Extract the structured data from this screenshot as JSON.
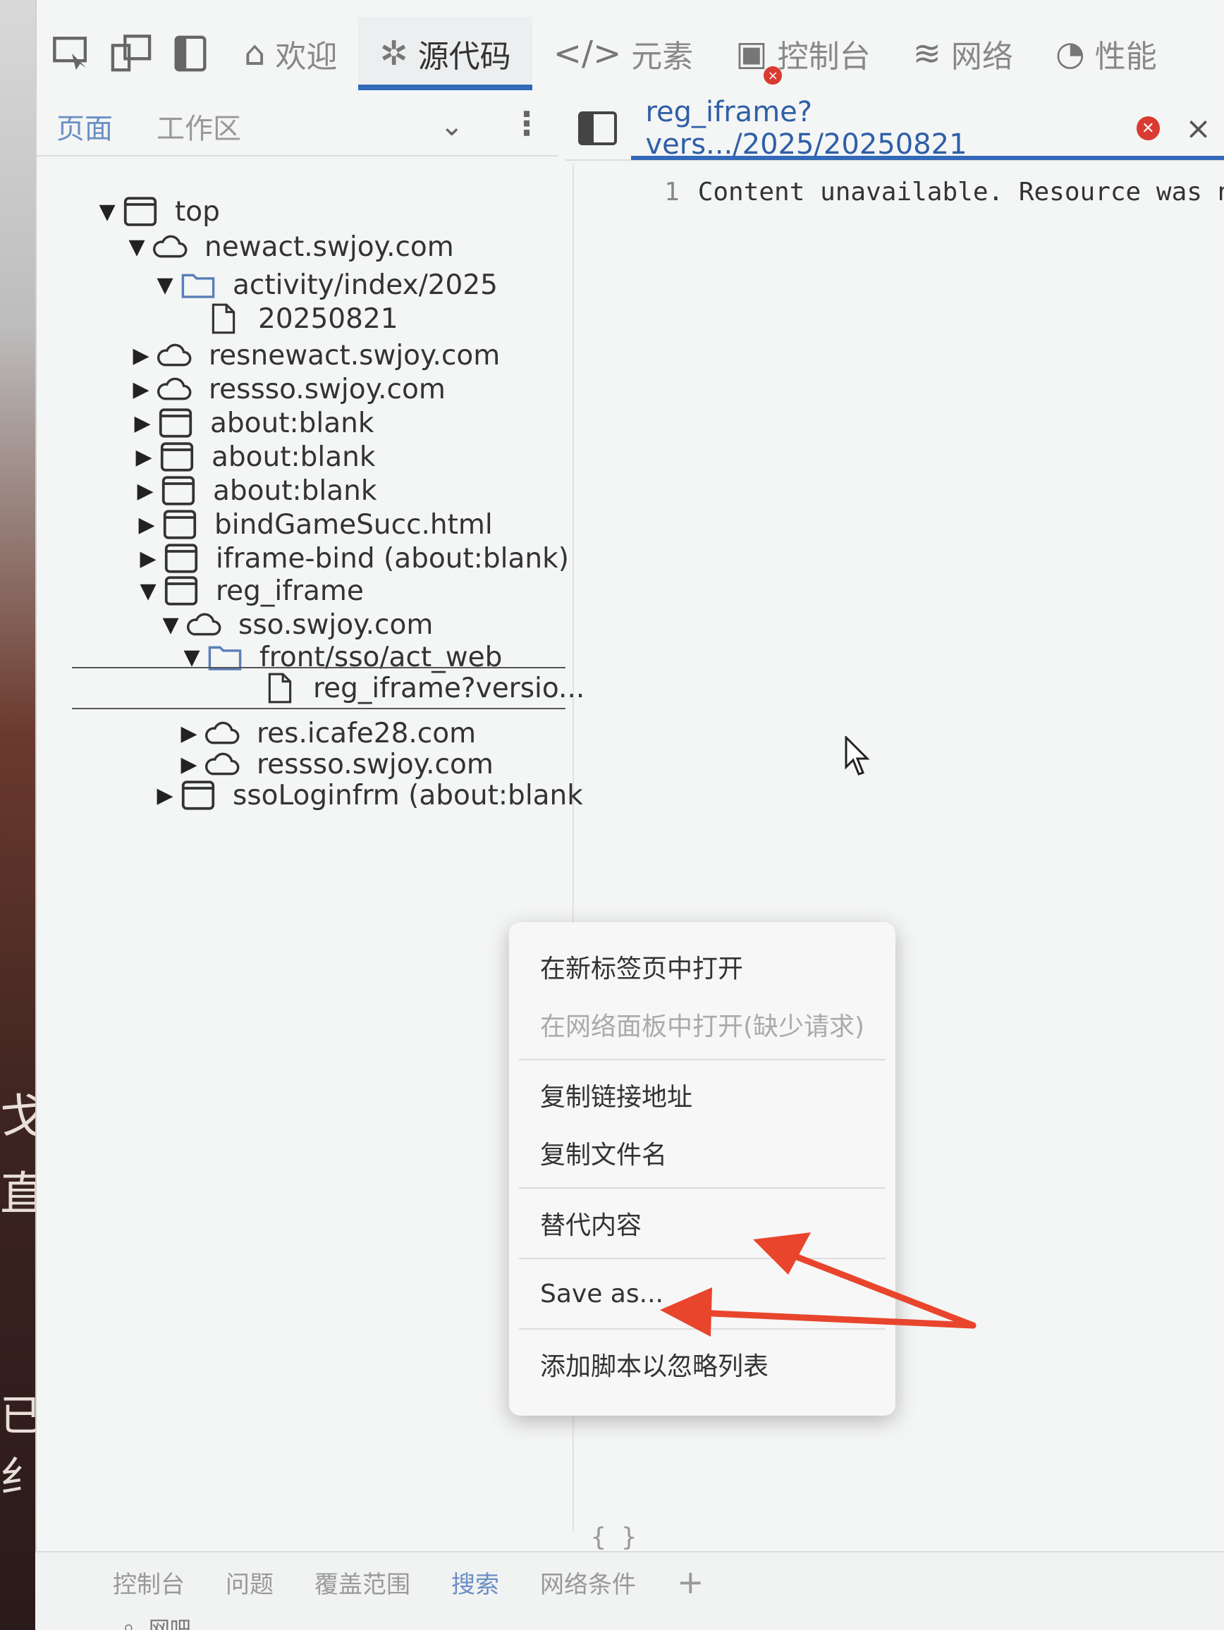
{
  "top_tabs": [
    {
      "label": "欢迎",
      "icon": "home-icon"
    },
    {
      "label": "源代码",
      "icon": "bug-icon",
      "active": true
    },
    {
      "label": "元素",
      "icon": "code-brackets-icon"
    },
    {
      "label": "控制台",
      "icon": "console-icon",
      "badge": "×"
    },
    {
      "label": "网络",
      "icon": "wifi-icon"
    },
    {
      "label": "性能",
      "icon": "gauge-icon"
    }
  ],
  "sub_tabs": {
    "page": "页面",
    "workspace": "工作区"
  },
  "editor": {
    "tab_label": "reg_iframe?vers.../2025/20250821",
    "close": "×",
    "line_number": "1",
    "line_text": "Content unavailable. Resource was not",
    "braces": "{ }"
  },
  "tree": [
    {
      "label": "top",
      "arrow": "▼",
      "icon": "frame"
    },
    {
      "label": "newact.swjoy.com",
      "arrow": "▼",
      "icon": "cloud"
    },
    {
      "label": "activity/index/2025",
      "arrow": "▼",
      "icon": "folder"
    },
    {
      "label": "20250821",
      "arrow": "",
      "icon": "file"
    },
    {
      "label": "resnewact.swjoy.com",
      "arrow": "▶",
      "icon": "cloud"
    },
    {
      "label": "ressso.swjoy.com",
      "arrow": "▶",
      "icon": "cloud"
    },
    {
      "label": "about:blank",
      "arrow": "▶",
      "icon": "frame"
    },
    {
      "label": "about:blank",
      "arrow": "▶",
      "icon": "frame"
    },
    {
      "label": "about:blank",
      "arrow": "▶",
      "icon": "frame"
    },
    {
      "label": "bindGameSucc.html",
      "arrow": "▶",
      "icon": "frame"
    },
    {
      "label": "iframe-bind (about:blank)",
      "arrow": "▶",
      "icon": "frame"
    },
    {
      "label": "reg_iframe",
      "arrow": "▼",
      "icon": "frame"
    },
    {
      "label": "sso.swjoy.com",
      "arrow": "▼",
      "icon": "cloud"
    },
    {
      "label": "front/sso/act_web",
      "arrow": "▼",
      "icon": "folder"
    },
    {
      "label": "reg_iframe?versio...",
      "arrow": "",
      "icon": "file"
    },
    {
      "label": "res.icafe28.com",
      "arrow": "▶",
      "icon": "cloud"
    },
    {
      "label": "ressso.swjoy.com",
      "arrow": "▶",
      "icon": "cloud"
    },
    {
      "label": "ssoLoginfrm (about:blank",
      "arrow": "▶",
      "icon": "frame"
    }
  ],
  "context_menu": [
    {
      "label": "在新标签页中打开",
      "disabled": false
    },
    {
      "label": "在网络面板中打开(缺少请求)",
      "disabled": true
    },
    {
      "label": "复制链接地址",
      "disabled": false
    },
    {
      "label": "复制文件名",
      "disabled": false
    },
    {
      "label": "替代内容",
      "disabled": false
    },
    {
      "label": "Save as...",
      "disabled": false
    },
    {
      "label": "添加脚本以忽略列表",
      "disabled": false
    }
  ],
  "bottom_tabs": [
    "控制台",
    "问题",
    "覆盖范围",
    "搜索",
    "网络条件",
    "+"
  ],
  "bottom_search_placeholder": "网吧",
  "background_glyphs": [
    "戈",
    "直",
    "已纟"
  ],
  "colors": {
    "accent": "#3269b8",
    "error": "#d93a31",
    "annotation_arrow": "#e8452c"
  }
}
